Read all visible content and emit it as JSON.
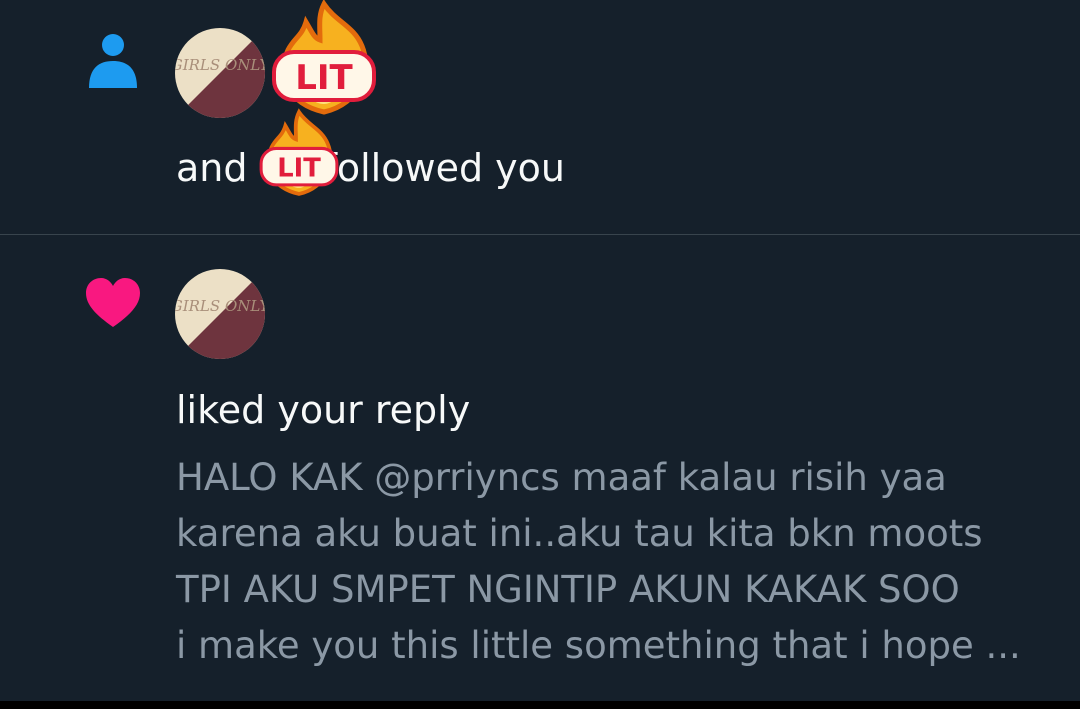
{
  "colors": {
    "background": "#15202b",
    "divider": "#38444d",
    "follow_icon": "#1d9bf0",
    "like_icon": "#f91880",
    "primary_text": "#f7f9f9",
    "secondary_text": "#8b98a5"
  },
  "notifications": [
    {
      "type": "follow",
      "icon": "person-icon",
      "avatar_label": "GIRLS ONLY",
      "sticker_text": "LIT",
      "text_before": "and",
      "text_after": "followed you"
    },
    {
      "type": "like",
      "icon": "heart-icon",
      "avatar_label": "GIRLS ONLY",
      "text": "liked your reply",
      "preview_lines": [
        "HALO KAK @prriyncs maaf kalau risih yaa",
        "karena aku buat ini..aku tau kita bkn moots",
        "TPI AKU SMPET NGINTIP AKUN KAKAK SOO",
        "i make you this little something that i hope ..."
      ]
    }
  ]
}
